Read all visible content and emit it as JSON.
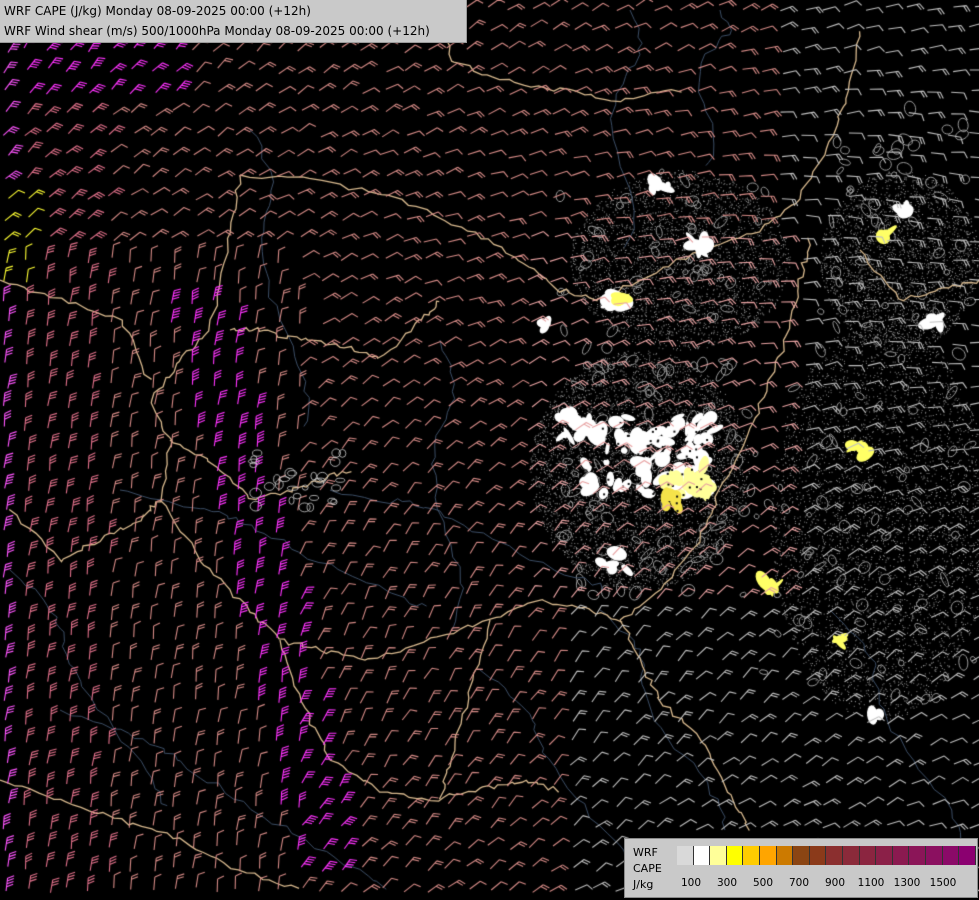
{
  "title": {
    "line1": "WRF CAPE (J/kg) Monday 08-09-2025 00:00 (+12h)",
    "line2": "WRF Wind shear (m/s) 500/1000hPa Monday 08-09-2025 00:00 (+12h)"
  },
  "legend": {
    "label1": "WRF",
    "label2": "CAPE",
    "label3": "J/kg",
    "colors": [
      "#d9d9d9",
      "#ffffff",
      "#ffff99",
      "#ffff00",
      "#ffcc00",
      "#ffa500",
      "#cc7a00",
      "#8b4513",
      "#8b3a1a",
      "#8b2f2f",
      "#8b2a3a",
      "#8b2540",
      "#8b2048",
      "#8b1a50",
      "#8b1558",
      "#8b1060",
      "#8b0a68",
      "#8b0070"
    ],
    "ticks": [
      "100",
      "300",
      "500",
      "700",
      "900",
      "1100",
      "1300",
      "1500"
    ]
  },
  "map_features": [
    "wind-barbs",
    "country-borders",
    "rivers",
    "cape-patches",
    "lifted-index-stipple"
  ]
}
